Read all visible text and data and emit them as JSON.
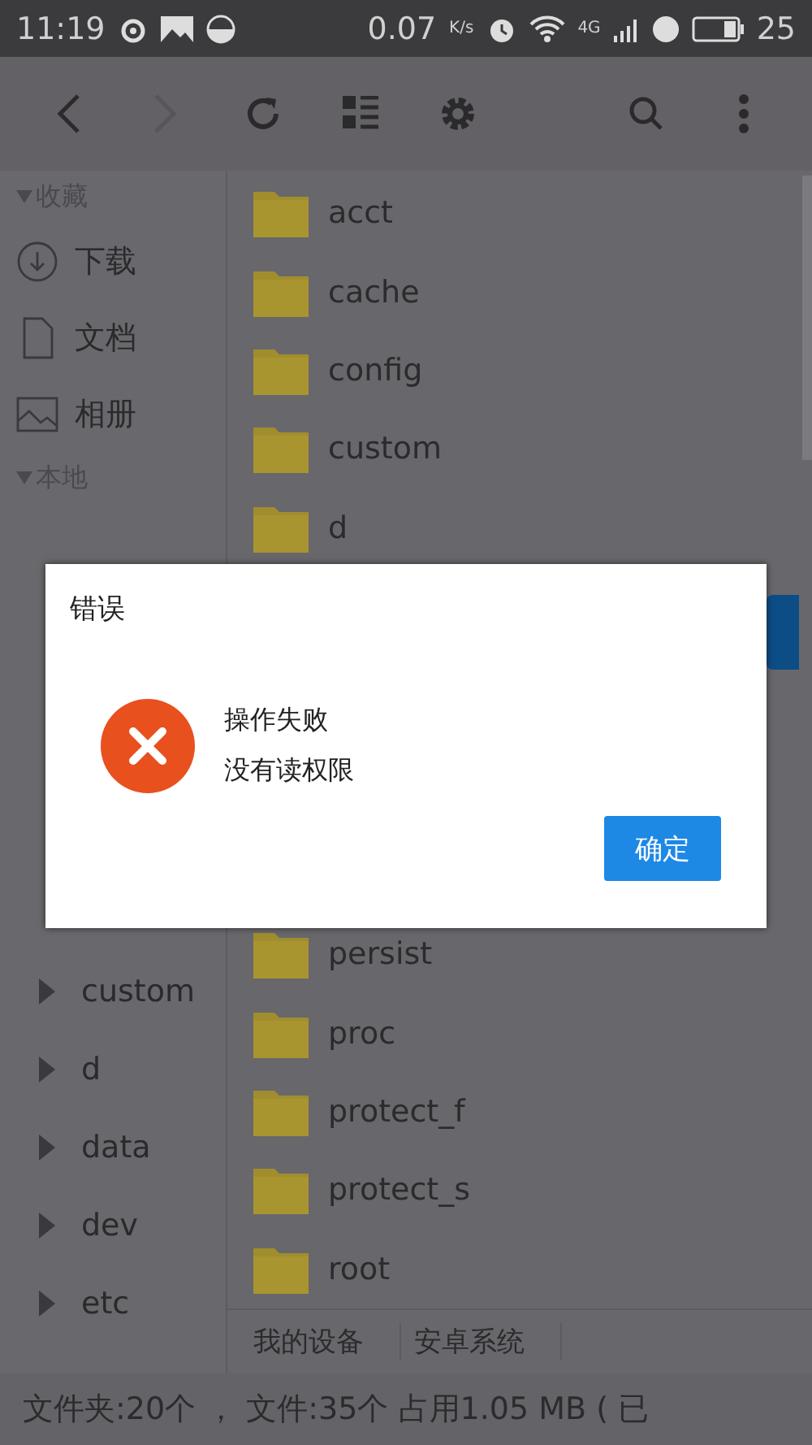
{
  "status_bar": {
    "time": "11:19",
    "speed": "0.07",
    "speed_unit": "K/s",
    "network": "4G",
    "battery": "25"
  },
  "toolbar": {
    "forward_disabled": true
  },
  "sidebar": {
    "sections": [
      {
        "title": "收藏",
        "expanded": true,
        "items": [
          {
            "label": "下载",
            "kind": "download"
          },
          {
            "label": "文档",
            "kind": "document"
          },
          {
            "label": "相册",
            "kind": "album"
          }
        ]
      },
      {
        "title": "本地",
        "expanded": true
      }
    ],
    "tree_below": [
      {
        "label": "custom",
        "expanded": false
      },
      {
        "label": "d",
        "expanded": false
      },
      {
        "label": "data",
        "expanded": false
      },
      {
        "label": "dev",
        "expanded": false
      },
      {
        "label": "etc",
        "expanded": false
      }
    ]
  },
  "files_above": [
    "acct",
    "cache",
    "config",
    "custom",
    "d"
  ],
  "files_below": [
    "persist",
    "proc",
    "protect_f",
    "protect_s",
    "root"
  ],
  "breadcrumb": [
    "我的设备",
    "安卓系统"
  ],
  "footer": "文件夹:20个 ， 文件:35个 占用1.05 MB ( 已",
  "dialog": {
    "title": "错误",
    "kind": "error",
    "message": "操作失败",
    "detail": "没有读权限",
    "button": "确定"
  }
}
